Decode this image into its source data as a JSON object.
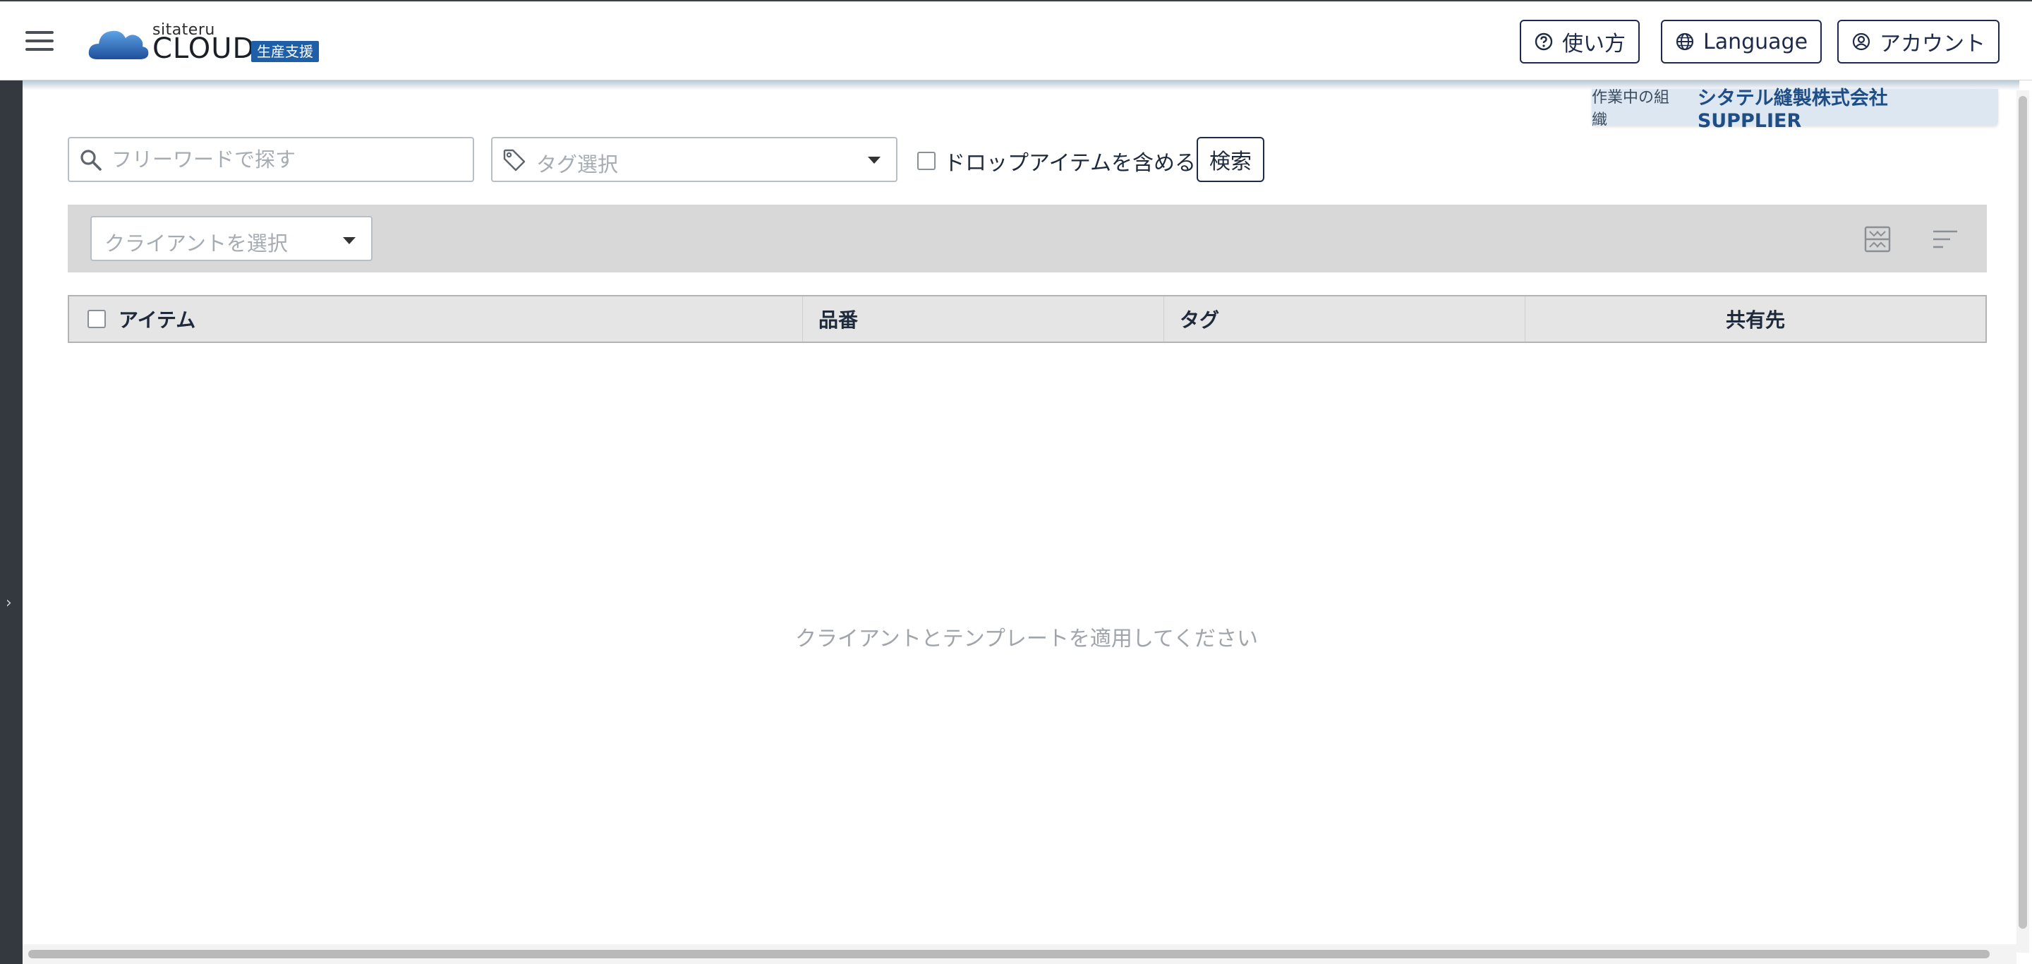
{
  "header": {
    "logo": {
      "small": "sitateru",
      "main": "CLOUD",
      "badge": "生産支援"
    },
    "help_label": "使い方",
    "language_label": "Language",
    "account_label": "アカウント"
  },
  "org": {
    "label": "作業中の組織",
    "name": "シタテル縫製株式会社 SUPPLIER"
  },
  "search": {
    "freeword_placeholder": "フリーワードで探す",
    "tag_placeholder": "タグ選択",
    "include_drop_label": "ドロップアイテムを含める",
    "search_button": "検索"
  },
  "filter": {
    "client_placeholder": "クライアントを選択"
  },
  "table": {
    "columns": [
      "アイテム",
      "品番",
      "タグ",
      "共有先"
    ],
    "empty_message": "クライアントとテンプレートを適用してください"
  },
  "colors": {
    "accent": "#1f5fa8",
    "border_dark": "#1e2a4a",
    "filter_bar": "#d8d8d8"
  }
}
